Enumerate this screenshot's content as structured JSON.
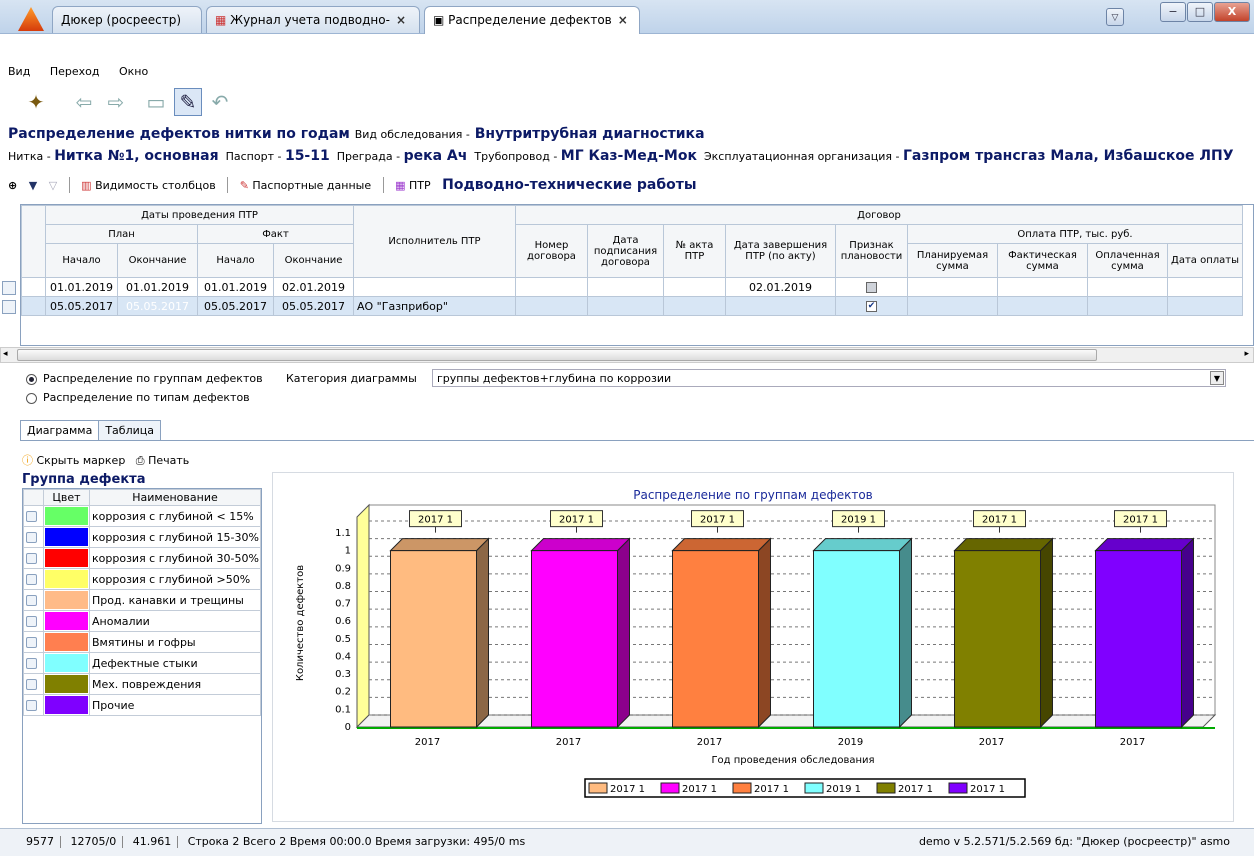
{
  "window": {
    "tabs": [
      {
        "label": "Дюкер (росреестр)"
      },
      {
        "label": "Журнал учета подводно-",
        "close": "×"
      },
      {
        "label": "Распределение дефектов",
        "close": "×"
      }
    ],
    "controls": [
      "−",
      "□",
      "X"
    ]
  },
  "menu": [
    "Вид",
    "Переход",
    "Окно"
  ],
  "header": {
    "title": "Распределение дефектов нитки по годам",
    "survey_label": "Вид обследования -",
    "survey_value": "Внутритрубная диагностика",
    "line_label": "Нитка -",
    "line_value": "Нитка №1, основная",
    "passport_label": "Паспорт -",
    "passport_value": "15-11",
    "barrier_label": "Преграда -",
    "barrier_value": "река Ач",
    "pipeline_label": "Трубопровод -",
    "pipeline_value": "МГ Каз-Мед-Мок",
    "org_label": "Эксплуатационная организация -",
    "org_value": "Газпром трансгаз Мала, Избашское ЛПУ"
  },
  "toolbar2": {
    "columns_btn": "Видимость столбцов",
    "passport_btn": "Паспортные данные",
    "ptr_btn": "ПТР",
    "section_title": "Подводно-технические работы"
  },
  "grid": {
    "h_dates": "Даты проведения ПТР",
    "h_plan": "План",
    "h_fact": "Факт",
    "h_start": "Начало",
    "h_end": "Окончание",
    "h_executor": "Исполнитель ПТР",
    "h_contract": "Договор",
    "h_contract_no": "Номер договора",
    "h_sign_date": "Дата подписания договора",
    "h_act_no": "№ акта ПТР",
    "h_finish_date": "Дата завершения ПТР (по акту)",
    "h_plan_sign": "Признак плановости",
    "h_payment": "Оплата ПТР, тыс. руб.",
    "h_plan_sum": "Планируемая сумма",
    "h_fact_sum": "Фактическая сумма",
    "h_paid_sum": "Оплаченная сумма",
    "h_pay_date": "Дата оплаты",
    "rows": [
      {
        "plan_start": "01.01.2019",
        "plan_end": "01.01.2019",
        "fact_start": "01.01.2019",
        "fact_end": "02.01.2019",
        "executor": "",
        "finish": "02.01.2019",
        "planned": false
      },
      {
        "plan_start": "05.05.2017",
        "plan_end": "05.05.2017",
        "fact_start": "05.05.2017",
        "fact_end": "05.05.2017",
        "executor": "АО \"Газприбор\"",
        "finish": "",
        "planned": true
      }
    ]
  },
  "options": {
    "radio1": "Распределение по группам дефектов",
    "radio2": "Распределение по типам дефектов",
    "category_label": "Категория диаграммы",
    "category_value": "группы дефектов+глубина по коррозии"
  },
  "tabs2": [
    "Диаграмма",
    "Таблица"
  ],
  "subbar": {
    "hide_marker": "Скрыть маркер",
    "print": "Печать"
  },
  "legend": {
    "title": "Группа дефекта",
    "col_color": "Цвет",
    "col_name": "Наименование",
    "items": [
      {
        "name": "коррозия с глубиной < 15%",
        "color": "#66ff66"
      },
      {
        "name": "коррозия с глубиной 15-30%",
        "color": "#0000ff"
      },
      {
        "name": "коррозия с глубиной 30-50%",
        "color": "#ff0000"
      },
      {
        "name": "коррозия с глубиной >50%",
        "color": "#ffff66"
      },
      {
        "name": "Прод. канавки и трещины",
        "color": "#ffbb88"
      },
      {
        "name": "Аномалии",
        "color": "#ff00ff"
      },
      {
        "name": "Вмятины и гофры",
        "color": "#ff7f50"
      },
      {
        "name": "Дефектные стыки",
        "color": "#80ffff"
      },
      {
        "name": "Мех. повреждения",
        "color": "#808000"
      },
      {
        "name": "Прочие",
        "color": "#7f00ff"
      }
    ]
  },
  "chart_data": {
    "type": "bar",
    "title": "Распределение по группам дефектов",
    "xlabel": "Год проведения обследования",
    "ylabel": "Количество дефектов",
    "categories": [
      "2017",
      "2017",
      "2017",
      "2019",
      "2017",
      "2017"
    ],
    "values": [
      1,
      1,
      1,
      1,
      1,
      1
    ],
    "data_labels": [
      "2017 1",
      "2017 1",
      "2017 1",
      "2019 1",
      "2017 1",
      "2017 1"
    ],
    "colors": [
      "#ffbb80",
      "#ff00ff",
      "#ff8040",
      "#80ffff",
      "#808000",
      "#8000ff"
    ],
    "legend_labels": [
      "2017 1",
      "2017 1",
      "2017 1",
      "2019 1",
      "2017 1",
      "2017 1"
    ],
    "ylim": [
      0,
      1.1
    ],
    "yticks": [
      "0",
      "0.1",
      "0.2",
      "0.3",
      "0.4",
      "0.5",
      "0.6",
      "0.7",
      "0.8",
      "0.9",
      "1",
      "1.1"
    ],
    "legend_position": "bottom",
    "grid": true
  },
  "status": {
    "s1": "9577",
    "s2": "12705/0",
    "s3": "41.961",
    "s4": "Строка 2 Всего 2 Время 00:00.0   Время загрузки: 495/0 ms",
    "right": "demo  v 5.2.571/5.2.569  бд: \"Дюкер (росреестр)\" asmo"
  }
}
